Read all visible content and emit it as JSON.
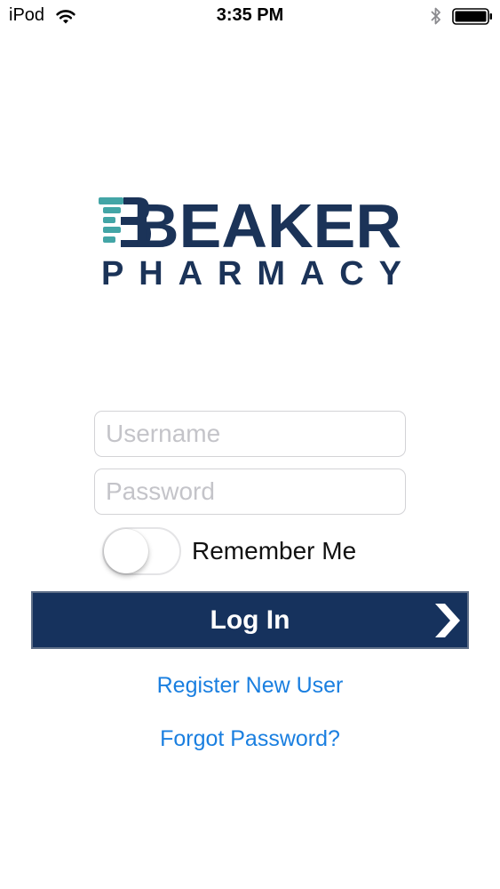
{
  "status_bar": {
    "device": "iPod",
    "time": "3:35 PM",
    "icons": [
      "wifi-icon",
      "bluetooth-icon",
      "battery-icon"
    ]
  },
  "logo": {
    "line1": "BEAKER",
    "line2": "PHARMACY",
    "colors": {
      "navy": "#1b3358",
      "teal": "#43a5a6"
    }
  },
  "login_form": {
    "username": {
      "value": "",
      "placeholder": "Username"
    },
    "password": {
      "value": "",
      "placeholder": "Password"
    },
    "remember_me": {
      "label": "Remember Me",
      "on": false
    },
    "login_button": {
      "label": "Log In",
      "icon": "chevron-right-icon",
      "color": "#16325d"
    },
    "register_link": "Register New User",
    "forgot_link": "Forgot Password?",
    "link_color": "#1a7fe0"
  }
}
